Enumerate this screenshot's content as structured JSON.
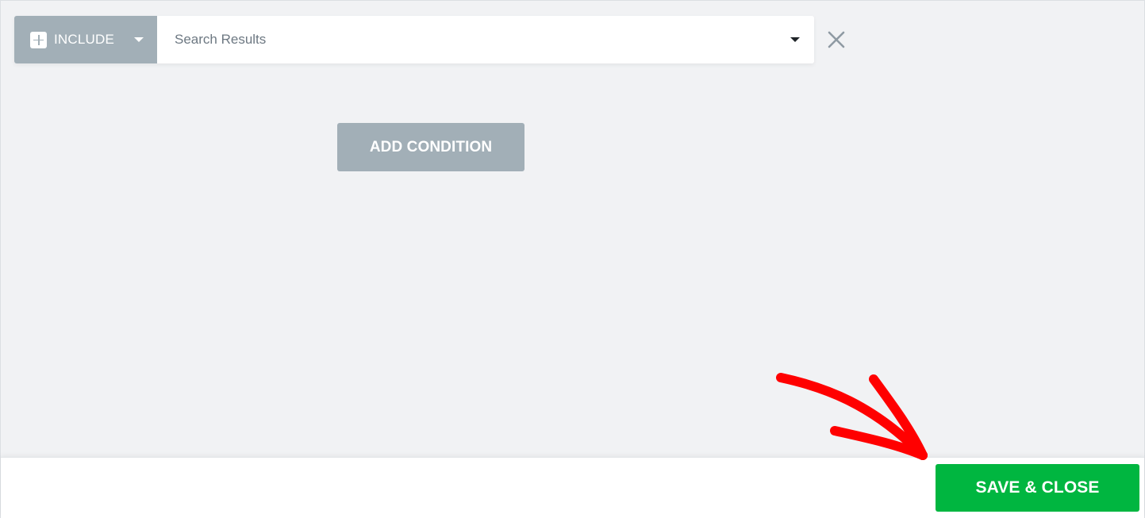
{
  "condition": {
    "type_label": "INCLUDE",
    "type_icon": "plus-square-icon",
    "target_value": "Search Results",
    "remove_icon": "close-icon"
  },
  "add_condition_label": "ADD CONDITION",
  "footer": {
    "save_label": "SAVE & CLOSE"
  },
  "colors": {
    "background": "#f1f2f4",
    "neutral_button": "#a2afb7",
    "save_button": "#00b640",
    "annotation": "#ff0000"
  }
}
